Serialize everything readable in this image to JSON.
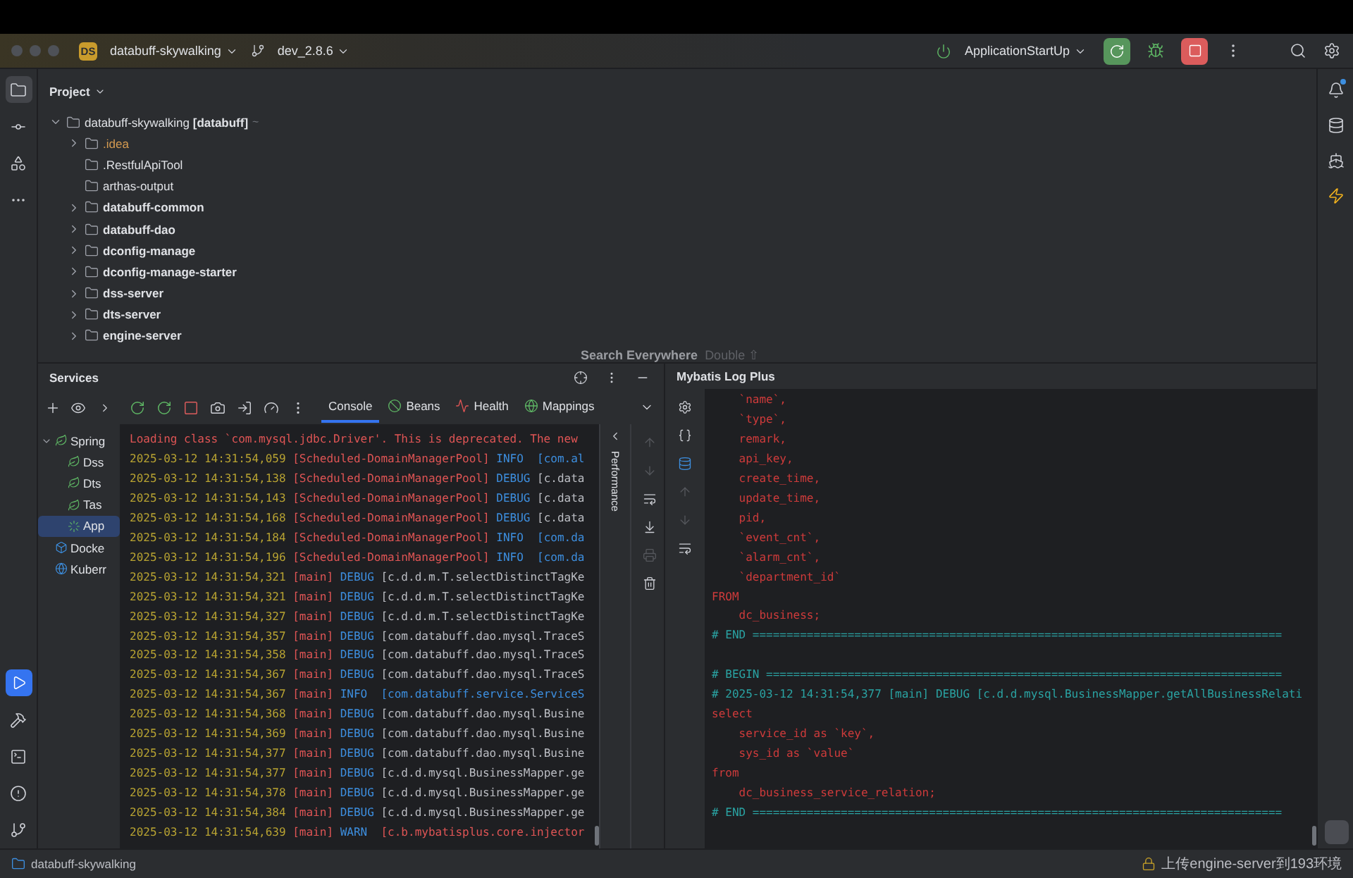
{
  "window": {
    "project_badge": "DS",
    "project": "databuff-skywalking",
    "branch": "dev_2.8.6",
    "run_config": "ApplicationStartUp"
  },
  "project_panel": {
    "title": "Project",
    "root": {
      "name": "databuff-skywalking **[databuff]**",
      "suffix": "~",
      "expanded": true,
      "children": [
        {
          "name": ".idea",
          "kind": "ignored",
          "expandable": true
        },
        {
          "name": ".RestfulApiTool",
          "kind": "folder",
          "expandable": false
        },
        {
          "name": "arthas-output",
          "kind": "folder",
          "expandable": false
        },
        {
          "name": "databuff-common",
          "kind": "module",
          "expandable": true
        },
        {
          "name": "databuff-dao",
          "kind": "module",
          "expandable": true
        },
        {
          "name": "dconfig-manage",
          "kind": "module",
          "expandable": true
        },
        {
          "name": "dconfig-manage-starter",
          "kind": "module",
          "expandable": true
        },
        {
          "name": "dss-server",
          "kind": "module",
          "expandable": true
        },
        {
          "name": "dts-server",
          "kind": "module",
          "expandable": true
        },
        {
          "name": "engine-server",
          "kind": "module",
          "expandable": true
        }
      ]
    }
  },
  "search_hint": {
    "label": "Search Everywhere",
    "shortcut": "Double ⇧"
  },
  "services": {
    "title": "Services",
    "tree": [
      {
        "name": "Spring",
        "selected": false,
        "expanded": true,
        "children": [
          {
            "name": "Dss",
            "selected": false
          },
          {
            "name": "Dts",
            "selected": false
          },
          {
            "name": "Tas",
            "selected": false
          },
          {
            "name": "App",
            "selected": true
          }
        ]
      },
      {
        "name": "Docke",
        "selected": false
      },
      {
        "name": "Kuberr",
        "selected": false
      }
    ],
    "tabs": [
      {
        "label": "Console",
        "selected": true
      },
      {
        "label": "Beans",
        "selected": false
      },
      {
        "label": "Health",
        "selected": false
      },
      {
        "label": "Mappings",
        "selected": false
      }
    ],
    "side_label": "Performance",
    "log": [
      {
        "kind": "message",
        "text": "Loading class `com.mysql.jdbc.Driver'. This is deprecated. The new"
      },
      {
        "kind": "info",
        "time": "2025-03-12 14:31:54,059",
        "thread": "[Scheduled-DomainManagerPool]",
        "level": "INFO",
        "logger": "[com.al"
      },
      {
        "kind": "debug",
        "time": "2025-03-12 14:31:54,138",
        "thread": "[Scheduled-DomainManagerPool]",
        "level": "DEBUG",
        "logger": "[c.data"
      },
      {
        "kind": "debug",
        "time": "2025-03-12 14:31:54,143",
        "thread": "[Scheduled-DomainManagerPool]",
        "level": "DEBUG",
        "logger": "[c.data"
      },
      {
        "kind": "debug",
        "time": "2025-03-12 14:31:54,168",
        "thread": "[Scheduled-DomainManagerPool]",
        "level": "DEBUG",
        "logger": "[c.data"
      },
      {
        "kind": "info",
        "time": "2025-03-12 14:31:54,184",
        "thread": "[Scheduled-DomainManagerPool]",
        "level": "INFO",
        "logger": "[com.da"
      },
      {
        "kind": "info",
        "time": "2025-03-12 14:31:54,196",
        "thread": "[Scheduled-DomainManagerPool]",
        "level": "INFO",
        "logger": "[com.da"
      },
      {
        "kind": "debug",
        "time": "2025-03-12 14:31:54,321",
        "thread": "[main]",
        "level": "DEBUG",
        "logger": "[c.d.d.m.T.selectDistinctTagKe"
      },
      {
        "kind": "debug",
        "time": "2025-03-12 14:31:54,321",
        "thread": "[main]",
        "level": "DEBUG",
        "logger": "[c.d.d.m.T.selectDistinctTagKe"
      },
      {
        "kind": "debug",
        "time": "2025-03-12 14:31:54,327",
        "thread": "[main]",
        "level": "DEBUG",
        "logger": "[c.d.d.m.T.selectDistinctTagKe"
      },
      {
        "kind": "debug",
        "time": "2025-03-12 14:31:54,357",
        "thread": "[main]",
        "level": "DEBUG",
        "logger": "[com.databuff.dao.mysql.TraceS"
      },
      {
        "kind": "debug",
        "time": "2025-03-12 14:31:54,358",
        "thread": "[main]",
        "level": "DEBUG",
        "logger": "[com.databuff.dao.mysql.TraceS"
      },
      {
        "kind": "debug",
        "time": "2025-03-12 14:31:54,367",
        "thread": "[main]",
        "level": "DEBUG",
        "logger": "[com.databuff.dao.mysql.TraceS"
      },
      {
        "kind": "info",
        "time": "2025-03-12 14:31:54,367",
        "thread": "[main]",
        "level": "INFO",
        "logger": "[com.databuff.service.ServiceS"
      },
      {
        "kind": "debug",
        "time": "2025-03-12 14:31:54,368",
        "thread": "[main]",
        "level": "DEBUG",
        "logger": "[com.databuff.dao.mysql.Busine"
      },
      {
        "kind": "debug",
        "time": "2025-03-12 14:31:54,369",
        "thread": "[main]",
        "level": "DEBUG",
        "logger": "[com.databuff.dao.mysql.Busine"
      },
      {
        "kind": "debug",
        "time": "2025-03-12 14:31:54,377",
        "thread": "[main]",
        "level": "DEBUG",
        "logger": "[com.databuff.dao.mysql.Busine"
      },
      {
        "kind": "debug",
        "time": "2025-03-12 14:31:54,377",
        "thread": "[main]",
        "level": "DEBUG",
        "logger": "[c.d.d.mysql.BusinessMapper.ge"
      },
      {
        "kind": "debug",
        "time": "2025-03-12 14:31:54,378",
        "thread": "[main]",
        "level": "DEBUG",
        "logger": "[c.d.d.mysql.BusinessMapper.ge"
      },
      {
        "kind": "debug",
        "time": "2025-03-12 14:31:54,384",
        "thread": "[main]",
        "level": "DEBUG",
        "logger": "[c.d.d.mysql.BusinessMapper.ge"
      },
      {
        "kind": "warn",
        "time": "2025-03-12 14:31:54,639",
        "thread": "[main]",
        "level": "WARN",
        "logger": "[c.b.mybatisplus.core.injector"
      }
    ]
  },
  "mybatis": {
    "title": "Mybatis Log Plus",
    "lines": [
      {
        "kind": "sql",
        "text": "    `name`,"
      },
      {
        "kind": "sql",
        "text": "    `type`,"
      },
      {
        "kind": "sql",
        "text": "    remark,"
      },
      {
        "kind": "sql",
        "text": "    api_key,"
      },
      {
        "kind": "sql",
        "text": "    create_time,"
      },
      {
        "kind": "sql",
        "text": "    update_time,"
      },
      {
        "kind": "sql",
        "text": "    pid,"
      },
      {
        "kind": "sql",
        "text": "    `event_cnt`,"
      },
      {
        "kind": "sql",
        "text": "    `alarm_cnt`,"
      },
      {
        "kind": "sql",
        "text": "    `department_id`"
      },
      {
        "kind": "sql",
        "text": "FROM"
      },
      {
        "kind": "sql",
        "text": "    dc_business;"
      },
      {
        "kind": "comment",
        "text": "# END =============================================================================="
      },
      {
        "kind": "blank"
      },
      {
        "kind": "comment",
        "text": "# BEGIN ============================================================================"
      },
      {
        "kind": "comment",
        "text": "# 2025-03-12 14:31:54,377 [main] DEBUG [c.d.d.mysql.BusinessMapper.getAllBusinessRelati"
      },
      {
        "kind": "sql",
        "text": "select"
      },
      {
        "kind": "sql",
        "text": "    service_id as `key`,"
      },
      {
        "kind": "sql",
        "text": "    sys_id as `value`"
      },
      {
        "kind": "sql",
        "text": "from"
      },
      {
        "kind": "sql",
        "text": "    dc_business_service_relation;"
      },
      {
        "kind": "comment",
        "text": "# END =============================================================================="
      }
    ]
  },
  "status_bar": {
    "project": "databuff-skywalking",
    "task": "上传engine-server到193环境"
  }
}
